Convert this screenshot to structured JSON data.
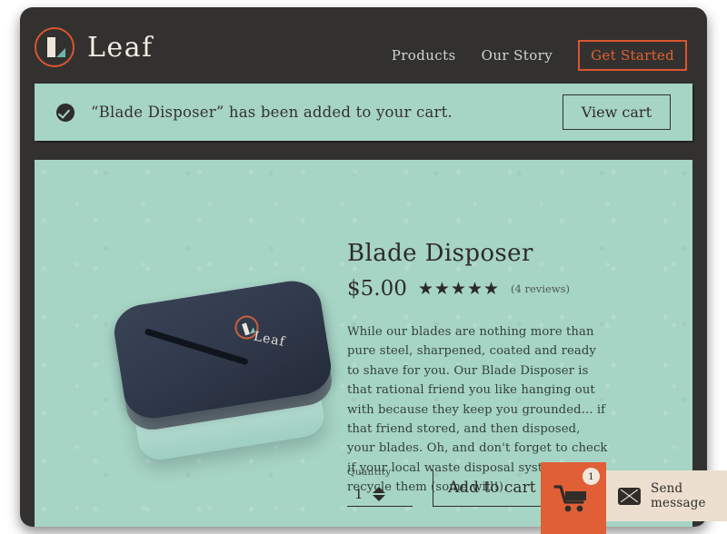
{
  "header": {
    "brand_name": "Leaf",
    "logo_icon": "leaf-logo-icon",
    "nav": [
      {
        "label": "Products",
        "name": "nav-link-products"
      },
      {
        "label": "Our Story",
        "name": "nav-link-our-story"
      }
    ],
    "cta_label": "Get Started",
    "accent_color": "#d9552f",
    "background_color": "#333130"
  },
  "notification": {
    "icon": "check-circle-icon",
    "message": "“Blade Disposer” has been added to your cart.",
    "button_label": "View cart",
    "background_color": "#a6d4c5"
  },
  "product": {
    "title": "Blade Disposer",
    "price": "$5.00",
    "stars": "★★★★★",
    "rating_value": 5,
    "reviews_label": "(4 reviews)",
    "description": "While our blades are nothing more than pure steel, sharpened, coated and ready to shave for you. Our Blade Disposer is that rational friend you like hanging out with because they keep you grounded... if that friend stored, and then disposed, your blades. Oh, and don't forget to check if your local waste disposal system will recycle them (some will!).",
    "image_alt": "blade-disposer-tin-photo",
    "image_logo_text": "Leaf"
  },
  "purchase": {
    "quantity_label": "Quantity",
    "quantity_value": "1",
    "add_to_cart_label": "Add to cart"
  },
  "widgets": {
    "cart": {
      "icon": "shopping-cart-icon",
      "badge_count": "1",
      "background_color": "#e05f37"
    },
    "message": {
      "icon": "envelope-icon",
      "label": "Send message",
      "background_color": "#ecdfcf"
    }
  }
}
